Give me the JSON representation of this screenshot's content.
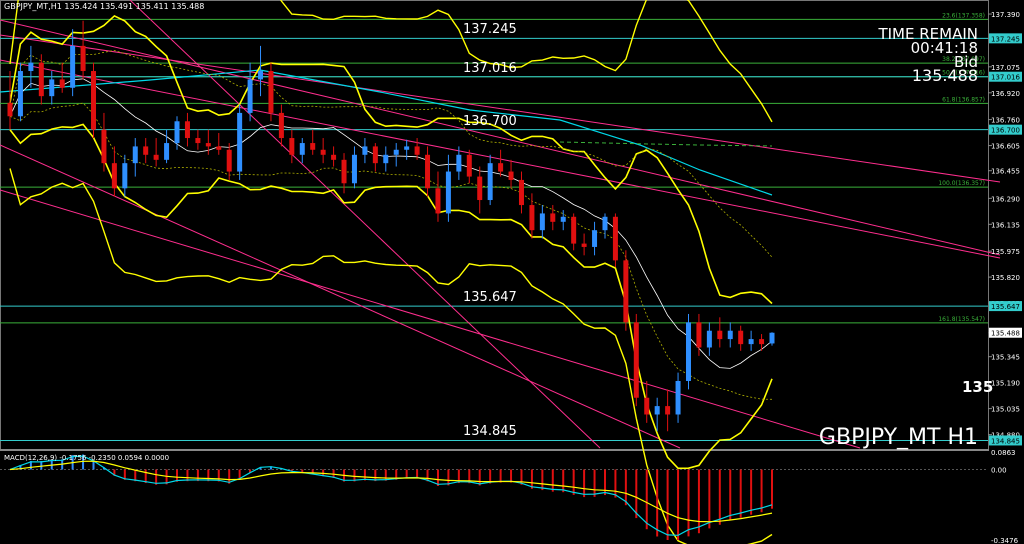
{
  "header": {
    "symbol_info": "GBPJPY_MT,H1  135.424 135.491 135.411 135.488",
    "macd_info": "MACD(12,26,9) -0.1756 -0.2350 0.0594 0.0000"
  },
  "info_panel": {
    "time_remain_label": "TIME REMAIN",
    "time_remain_value": "00:41:18",
    "bid_label": "Bid",
    "bid_value": "135.488"
  },
  "watermark": "GBPJPY_MT H1",
  "partial_price": "135",
  "colors": {
    "bull": "#2f8fff",
    "bear": "#e01010",
    "band": "#ffff00",
    "trend": "#ff2e8e",
    "cyan": "#00d8e8",
    "fib": "#3ab03a",
    "hline": "#33cccc"
  },
  "chart_data": [
    {
      "type": "candlestick",
      "timeframe": "H1",
      "ylim": [
        134.8,
        137.45
      ],
      "y_ticks": [
        "137.390",
        "137.245",
        "137.075",
        "136.920",
        "136.760",
        "136.605",
        "136.455",
        "136.290",
        "136.135",
        "135.975",
        "135.820",
        "135.665",
        "135.488",
        "135.345",
        "135.190",
        "135.035",
        "134.880"
      ],
      "horizontal_levels": [
        {
          "label": "137.245",
          "value": 137.245
        },
        {
          "label": "137.016",
          "value": 137.016
        },
        {
          "label": "136.700",
          "value": 136.7
        },
        {
          "label": "135.647",
          "value": 135.647
        },
        {
          "label": "134.845",
          "value": 134.845
        }
      ],
      "price_tags": [
        "137.245",
        "137.016",
        "136.700",
        "135.647",
        "134.845",
        "135.488"
      ],
      "fibonacci": [
        {
          "label": "23.6(137.358)",
          "value": 137.358
        },
        {
          "label": "38.2(137.097)",
          "value": 137.097
        },
        {
          "label": "50.0(137.016)",
          "value": 137.016
        },
        {
          "label": "61.8(136.857)",
          "value": 136.857
        },
        {
          "label": "100.0(136.357)",
          "value": 136.357
        },
        {
          "label": "161.8(135.547)",
          "value": 135.547
        }
      ],
      "ohlc": [
        [
          136.86,
          137.05,
          136.7,
          136.78
        ],
        [
          136.78,
          137.1,
          136.75,
          137.05
        ],
        [
          137.05,
          137.2,
          136.95,
          137.1
        ],
        [
          137.1,
          137.15,
          136.85,
          136.9
        ],
        [
          136.9,
          137.05,
          136.85,
          137.0
        ],
        [
          137.0,
          137.1,
          136.92,
          136.95
        ],
        [
          136.95,
          137.3,
          136.9,
          137.2
        ],
        [
          137.2,
          137.35,
          137.0,
          137.05
        ],
        [
          137.05,
          137.1,
          136.65,
          136.7
        ],
        [
          136.7,
          136.8,
          136.45,
          136.5
        ],
        [
          136.5,
          136.6,
          136.3,
          136.35
        ],
        [
          136.35,
          136.55,
          136.3,
          136.5
        ],
        [
          136.5,
          136.65,
          136.42,
          136.6
        ],
        [
          136.6,
          136.65,
          136.5,
          136.55
        ],
        [
          136.55,
          136.65,
          136.48,
          136.52
        ],
        [
          136.52,
          136.7,
          136.5,
          136.62
        ],
        [
          136.62,
          136.78,
          136.58,
          136.75
        ],
        [
          136.75,
          136.8,
          136.6,
          136.65
        ],
        [
          136.65,
          136.7,
          136.58,
          136.62
        ],
        [
          136.62,
          136.7,
          136.55,
          136.6
        ],
        [
          136.6,
          136.68,
          136.55,
          136.58
        ],
        [
          136.58,
          136.62,
          136.4,
          136.45
        ],
        [
          136.45,
          136.85,
          136.4,
          136.8
        ],
        [
          136.8,
          137.1,
          136.75,
          137.0
        ],
        [
          137.0,
          137.2,
          136.9,
          137.05
        ],
        [
          137.05,
          137.1,
          136.75,
          136.8
        ],
        [
          136.8,
          136.85,
          136.6,
          136.65
        ],
        [
          136.65,
          136.7,
          136.5,
          136.55
        ],
        [
          136.55,
          136.65,
          136.5,
          136.62
        ],
        [
          136.62,
          136.7,
          136.55,
          136.58
        ],
        [
          136.58,
          136.65,
          136.5,
          136.55
        ],
        [
          136.55,
          136.6,
          136.48,
          136.52
        ],
        [
          136.52,
          136.56,
          136.32,
          136.38
        ],
        [
          136.38,
          136.6,
          136.35,
          136.55
        ],
        [
          136.55,
          136.65,
          136.5,
          136.6
        ],
        [
          136.6,
          136.62,
          136.45,
          136.5
        ],
        [
          136.5,
          136.6,
          136.45,
          136.55
        ],
        [
          136.55,
          136.62,
          136.48,
          136.58
        ],
        [
          136.58,
          136.64,
          136.52,
          136.6
        ],
        [
          136.6,
          136.65,
          136.52,
          136.55
        ],
        [
          136.55,
          136.6,
          136.3,
          136.35
        ],
        [
          136.35,
          136.45,
          136.15,
          136.2
        ],
        [
          136.2,
          136.55,
          136.15,
          136.45
        ],
        [
          136.45,
          136.6,
          136.4,
          136.55
        ],
        [
          136.55,
          136.58,
          136.38,
          136.42
        ],
        [
          136.42,
          136.48,
          136.2,
          136.28
        ],
        [
          136.28,
          136.55,
          136.25,
          136.5
        ],
        [
          136.5,
          136.58,
          136.42,
          136.45
        ],
        [
          136.45,
          136.52,
          136.35,
          136.4
        ],
        [
          136.4,
          136.45,
          136.2,
          136.25
        ],
        [
          136.25,
          136.32,
          136.05,
          136.1
        ],
        [
          136.1,
          136.25,
          136.05,
          136.2
        ],
        [
          136.2,
          136.25,
          136.1,
          136.15
        ],
        [
          136.15,
          136.22,
          136.1,
          136.18
        ],
        [
          136.18,
          136.2,
          135.98,
          136.02
        ],
        [
          136.02,
          136.08,
          135.95,
          136.0
        ],
        [
          136.0,
          136.15,
          135.95,
          136.1
        ],
        [
          136.1,
          136.2,
          136.05,
          136.18
        ],
        [
          136.18,
          136.2,
          135.88,
          135.92
        ],
        [
          135.92,
          135.98,
          135.5,
          135.55
        ],
        [
          135.55,
          135.6,
          135.05,
          135.1
        ],
        [
          135.1,
          135.2,
          134.95,
          135.0
        ],
        [
          135.0,
          135.1,
          134.9,
          135.05
        ],
        [
          135.05,
          135.15,
          134.9,
          135.0
        ],
        [
          135.0,
          135.25,
          134.95,
          135.2
        ],
        [
          135.2,
          135.6,
          135.15,
          135.55
        ],
        [
          135.55,
          135.6,
          135.35,
          135.4
        ],
        [
          135.4,
          135.55,
          135.35,
          135.5
        ],
        [
          135.5,
          135.58,
          135.4,
          135.45
        ],
        [
          135.45,
          135.55,
          135.4,
          135.5
        ],
        [
          135.5,
          135.53,
          135.38,
          135.42
        ],
        [
          135.42,
          135.5,
          135.38,
          135.45
        ],
        [
          135.45,
          135.48,
          135.38,
          135.42
        ],
        [
          135.424,
          135.491,
          135.411,
          135.488
        ]
      ]
    },
    {
      "type": "macd",
      "params": "12,26,9",
      "ylim": [
        -0.3476,
        0.0863
      ],
      "y_ticks": [
        "0.0863",
        "0.00",
        "-0.3476"
      ],
      "values": {
        "macd": -0.1756,
        "signal": -0.235,
        "histogram": 0.0594
      }
    }
  ]
}
